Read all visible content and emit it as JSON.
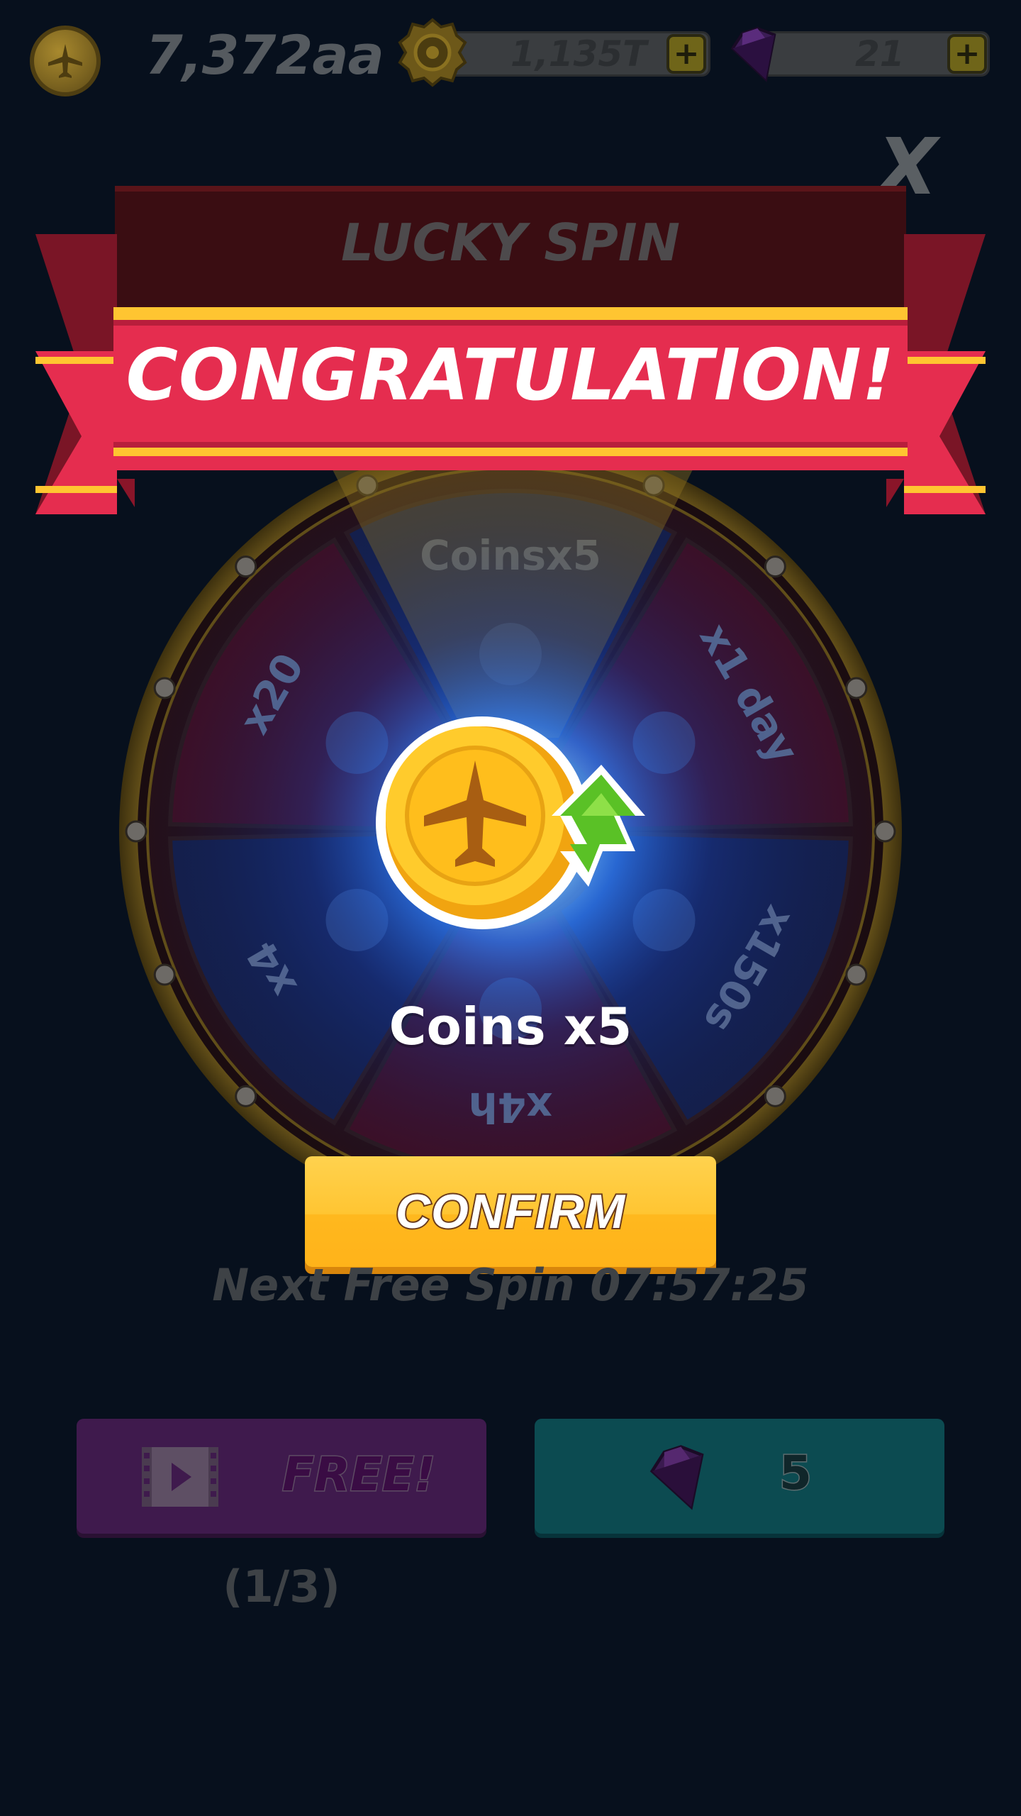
{
  "topbar": {
    "coins": "7,372aa",
    "tickets": "1,135T",
    "gems": "21",
    "plus_symbol": "+"
  },
  "modal": {
    "title": "LUCKY SPIN",
    "close_label": "X",
    "banner_text": "CONGRATULATION!"
  },
  "wheel": {
    "segments": [
      {
        "label": "Coinsx5",
        "icon": "coin-boost-icon",
        "color": "#141f4a"
      },
      {
        "label": "x1 day",
        "icon": "stopwatch-icon",
        "color": "#3e0f24"
      },
      {
        "label": "x150s",
        "icon": "rocket-icon",
        "color": "#141f4a"
      },
      {
        "label": "x4h",
        "icon": "clock-icon",
        "color": "#3e0f24"
      },
      {
        "label": "x4",
        "icon": "crate-icon",
        "color": "#141f4a"
      },
      {
        "label": "x20",
        "icon": "gems-icon",
        "color": "#3e0f24"
      }
    ]
  },
  "prize": {
    "label": "Coins x5",
    "icon": "coin-airplane-boost-icon"
  },
  "confirm_label": "CONFIRM",
  "next_spin": "Next Free Spin 07:57:25",
  "free_button": {
    "label": "FREE!",
    "icon": "video-icon",
    "count": "(1/3)"
  },
  "gem_button": {
    "icon": "gem-icon",
    "cost": "5"
  },
  "colors": {
    "background": "#07101d",
    "ribbon": "#e52d4f",
    "ribbon_stripe": "#ffc531",
    "confirm": "#ffc532",
    "wheel_rim": "#5c4716"
  }
}
